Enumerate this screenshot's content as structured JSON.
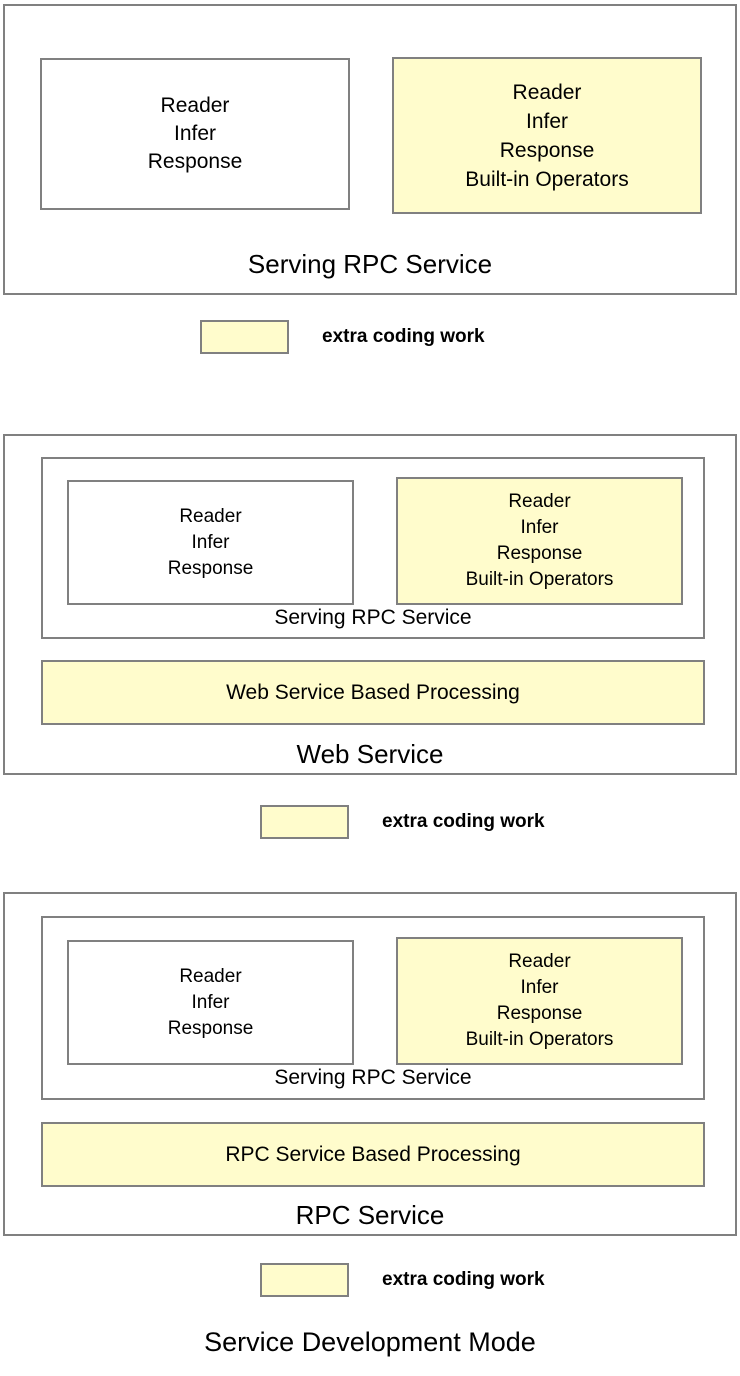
{
  "colors": {
    "highlight_fill": "#FFFCCC",
    "border": "#808080",
    "background": "#FFFFFF",
    "text": "#000000"
  },
  "figure": {
    "title": "Service Development Mode"
  },
  "legend": {
    "label": "extra coding work",
    "swatch_fill": "#FFFCCC"
  },
  "panels": [
    {
      "id": "serving-rpc-service",
      "label": "Serving RPC Service",
      "plain_box": {
        "lines": [
          "Reader",
          "Infer",
          "Response"
        ],
        "highlighted": false
      },
      "highlighted_box": {
        "lines": [
          "Reader",
          "Infer",
          "Response",
          "Built-in Operators"
        ],
        "highlighted": true
      }
    },
    {
      "id": "web-service",
      "label": "Web Service",
      "inner_label": "Serving RPC Service",
      "plain_box": {
        "lines": [
          "Reader",
          "Infer",
          "Response"
        ],
        "highlighted": false
      },
      "highlighted_box": {
        "lines": [
          "Reader",
          "Infer",
          "Response",
          "Built-in Operators"
        ],
        "highlighted": true
      },
      "processing_bar": {
        "label": "Web Service Based Processing",
        "highlighted": true
      }
    },
    {
      "id": "rpc-service",
      "label": "RPC Service",
      "inner_label": "Serving RPC Service",
      "plain_box": {
        "lines": [
          "Reader",
          "Infer",
          "Response"
        ],
        "highlighted": false
      },
      "highlighted_box": {
        "lines": [
          "Reader",
          "Infer",
          "Response",
          "Built-in Operators"
        ],
        "highlighted": true
      },
      "processing_bar": {
        "label": "RPC Service Based Processing",
        "highlighted": true
      }
    }
  ]
}
